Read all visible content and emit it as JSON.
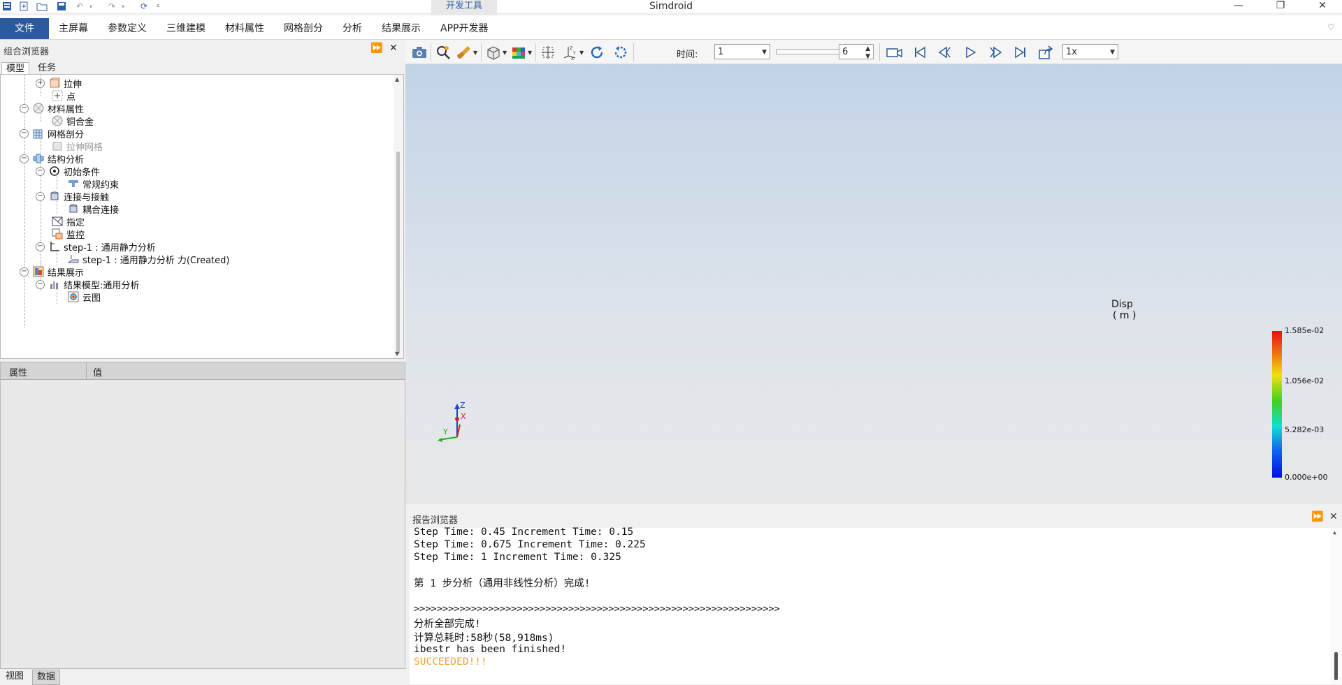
{
  "window": {
    "title": "Simdroid",
    "contextual_tab": "开发工具",
    "controls": [
      "—",
      "❐",
      "✕"
    ]
  },
  "quick_access": [
    "app-icon",
    "new-icon",
    "open-folder-icon",
    "save-icon",
    "undo-icon",
    "redo-icon",
    "refresh-icon",
    "customize-icon"
  ],
  "menu": {
    "file": "文件",
    "items": [
      "主屏幕",
      "参数定义",
      "三维建模",
      "材料属性",
      "网格剖分",
      "分析",
      "结果展示",
      "APP开发器"
    ]
  },
  "left_panel": {
    "title": "组合浏览器",
    "tabs": [
      "模型",
      "任务"
    ],
    "active_tab": "模型",
    "tree": [
      {
        "label": "拉伸",
        "expander": "+",
        "icon": "extrude-icon"
      },
      {
        "label": "点",
        "icon": "point-icon"
      },
      {
        "label": "材料属性",
        "expander": "−",
        "icon": "material-icon"
      },
      {
        "label": "铜合金",
        "icon": "material-item-icon"
      },
      {
        "label": "网格剖分",
        "expander": "−",
        "icon": "mesh-icon"
      },
      {
        "label": "拉伸网格",
        "icon": "mesh-item-icon",
        "disabled": true
      },
      {
        "label": "结构分析",
        "expander": "−",
        "icon": "structure-icon"
      },
      {
        "label": "初始条件",
        "expander": "−",
        "icon": "initial-condition-icon"
      },
      {
        "label": "常规约束",
        "icon": "constraint-icon"
      },
      {
        "label": "连接与接触",
        "expander": "−",
        "icon": "connection-icon"
      },
      {
        "label": "耦合连接",
        "icon": "coupling-icon"
      },
      {
        "label": "指定",
        "icon": "specify-icon"
      },
      {
        "label": "监控",
        "icon": "monitor-icon"
      },
      {
        "label": "step-1 : 通用静力分析",
        "expander": "−",
        "icon": "step-icon"
      },
      {
        "label": "step-1 : 通用静力分析 力(Created)",
        "icon": "load-icon"
      },
      {
        "label": "结果展示",
        "expander": "−",
        "icon": "results-icon"
      },
      {
        "label": "结果模型:通用分析",
        "expander": "−",
        "icon": "result-model-icon"
      },
      {
        "label": "云图",
        "icon": "contour-icon"
      }
    ]
  },
  "properties": {
    "col_property": "属性",
    "col_value": "值"
  },
  "bottom_tabs": [
    "视图",
    "数据"
  ],
  "toolbar": {
    "time_label": "时间:",
    "time_value": "1",
    "frame_value": "6",
    "speed_value": "1x"
  },
  "legend": {
    "title": "Disp",
    "unit": "( m )",
    "ticks": [
      "1.585e-02",
      "1.056e-02",
      "5.282e-03",
      "0.000e+00"
    ]
  },
  "axes": {
    "z": "Z",
    "x": "X",
    "y": "Y"
  },
  "report": {
    "title": "报告浏览器",
    "lines": [
      "Step Time: 0.45 Increment Time: 0.15",
      "Step Time: 0.675 Increment Time: 0.225",
      "Step Time: 1 Increment Time: 0.325",
      "",
      "第 1 步分析（通用非线性分析）完成!",
      "",
      ">>>>>>>>>>>>>>>>>>>>>>>>>>>>>>>>>>>>>>>>>>>>>>>>>>>>>>>>>>>>>>>>",
      "分析全部完成!",
      "计算总耗时:58秒(58,918ms)",
      "ibestr has been finished!"
    ],
    "success": "SUCCEEDED!!!",
    "success_color": "#f0a030"
  }
}
